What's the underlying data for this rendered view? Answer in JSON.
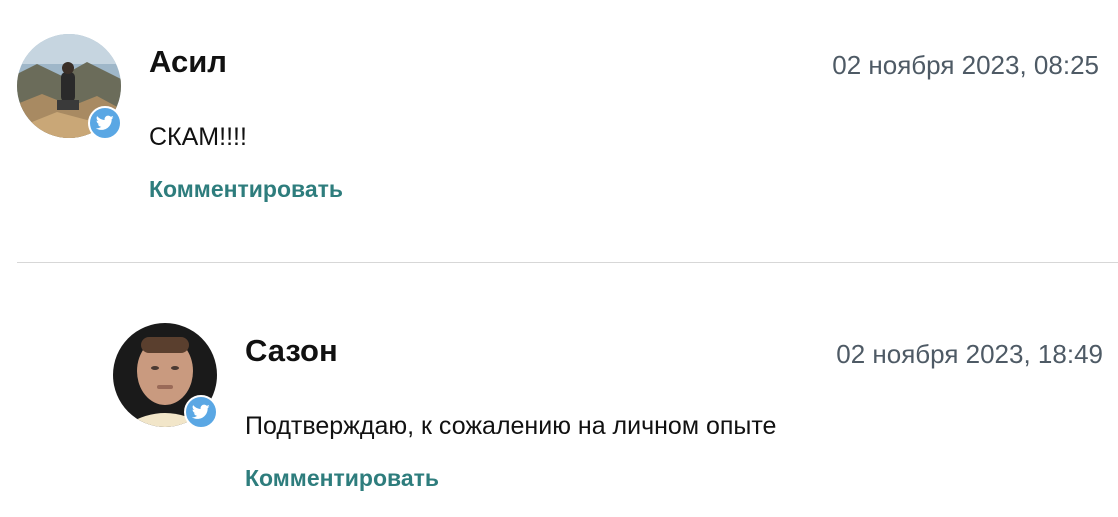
{
  "comments": [
    {
      "author": "Асил",
      "date": "02 ноября 2023, 08:25",
      "text": "СКАМ!!!!",
      "reply_label": "Комментировать",
      "badge_icon": "twitter-icon"
    },
    {
      "author": "Сазон",
      "date": "02 ноября 2023, 18:49",
      "text": "Подтверждаю, к сожалению на личном опыте",
      "reply_label": "Комментировать",
      "badge_icon": "twitter-icon"
    }
  ],
  "colors": {
    "accent_link": "#2e7d7d",
    "date_text": "#4e5a65",
    "twitter_badge": "#5aa7e4",
    "divider": "#d7d7d7"
  }
}
